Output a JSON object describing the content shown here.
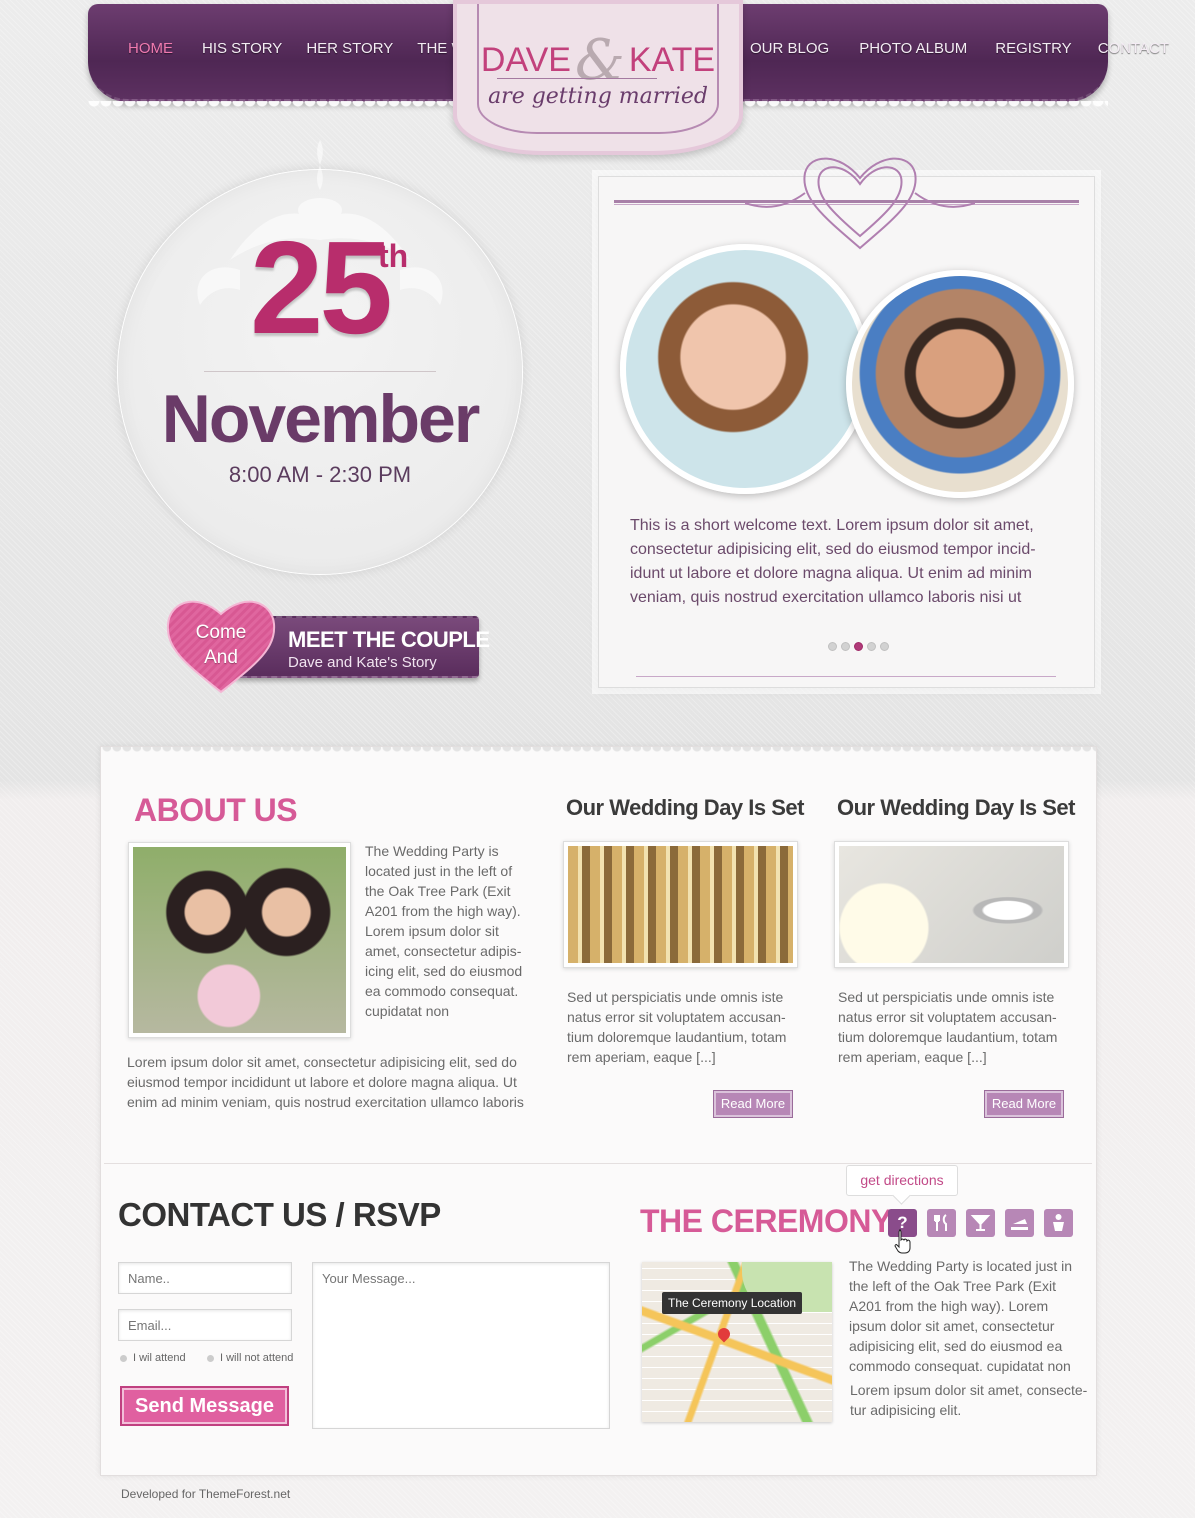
{
  "nav": {
    "left": [
      "HOME",
      "HIS STORY",
      "HER STORY",
      "THE  WEDDING"
    ],
    "right": [
      "OUR BLOG",
      "PHOTO ALBUM",
      "REGISTRY",
      "CONTACT"
    ]
  },
  "logo": {
    "name1": "DAVE",
    "amp": "&",
    "name2": "KATE",
    "tagline": "are getting married"
  },
  "date": {
    "day": "25",
    "suffix": "th",
    "month": "November",
    "time": "8:00 AM - 2:30 PM"
  },
  "meet": {
    "heart_line1": "Come",
    "heart_line2": "And",
    "title": "MEET THE COUPLE",
    "subtitle": "Dave and Kate's Story"
  },
  "welcome": {
    "text": "This is a short welcome text. Lorem ipsum dolor sit amet, consectetur adipisicing elit, sed do eiusmod tempor incid-idunt ut labore et dolore magna aliqua. Ut enim ad minim veniam, quis nostrud exercitation ullamco laboris nisi ut",
    "active_slide": 3,
    "slide_count": 5
  },
  "about": {
    "title": "ABOUT US",
    "side_text": "The Wedding Party is located just in the left of the Oak Tree Park (Exit A201 from the high way). Lorem ipsum dolor sit amet, consectetur adipis-icing elit, sed do eiusmod ea commodo consequat. cupidatat non",
    "bottom_text": "Lorem ipsum dolor sit amet, consectetur adipisicing elit, sed do eiusmod tempor incididunt ut labore et dolore magna aliqua. Ut enim ad minim veniam, quis nostrud exercitation ullamco laboris"
  },
  "posts": [
    {
      "title": "Our Wedding Day Is Set",
      "text": "Sed ut perspiciatis unde omnis iste natus error sit voluptatem accusan-tium doloremque laudantium, totam rem aperiam, eaque [...]",
      "button": "Read More"
    },
    {
      "title": "Our Wedding Day Is Set",
      "text": "Sed ut perspiciatis unde omnis iste natus error sit voluptatem accusan-tium doloremque laudantium, totam rem aperiam, eaque [...]",
      "button": "Read More"
    }
  ],
  "contact": {
    "title": "CONTACT US / RSVP",
    "name_placeholder": "Name..",
    "email_placeholder": "Email...",
    "message_placeholder": "Your Message...",
    "attend": "I wil attend",
    "not_attend": "I will not attend",
    "send": "Send Message"
  },
  "ceremony": {
    "title": "THE CEREMONY",
    "tooltip": "get directions",
    "icons": [
      "question-icon",
      "cutlery-icon",
      "cocktail-icon",
      "cake-icon",
      "baby-icon"
    ],
    "map_label": "The Ceremony Location",
    "text1": "The Wedding Party is located just in the left of the Oak Tree Park (Exit A201 from the high way). Lorem ipsum dolor sit amet, consectetur adipisicing elit, sed do eiusmod ea commodo consequat. cupidatat non",
    "text2": "Lorem ipsum dolor sit amet, consecte-tur adipisicing elit."
  },
  "footer": "Developed for ThemeForest.net",
  "colors": {
    "purple": "#5c3060",
    "pink": "#d65a97",
    "accent": "#b82d6c"
  }
}
